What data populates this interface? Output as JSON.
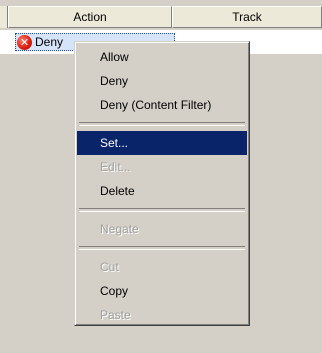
{
  "table": {
    "columns": [
      "Action",
      "Track"
    ],
    "row": {
      "icon": "deny-icon",
      "text": "Deny",
      "track_value": "..."
    }
  },
  "context_menu": {
    "groups": [
      [
        "Allow",
        "Deny",
        "Deny (Content Filter)"
      ],
      [
        "Set...",
        "Edit...",
        "Delete"
      ],
      [
        "Negate"
      ],
      [
        "Cut",
        "Copy",
        "Paste"
      ]
    ],
    "highlighted": "Set...",
    "disabled": [
      "Edit...",
      "Negate",
      "Cut",
      "Paste"
    ]
  },
  "colors": {
    "menu_background": "#d4d0c8",
    "highlight": "#0a246a",
    "disabled_text": "#a0a0a0",
    "deny_icon": "#e02010"
  }
}
